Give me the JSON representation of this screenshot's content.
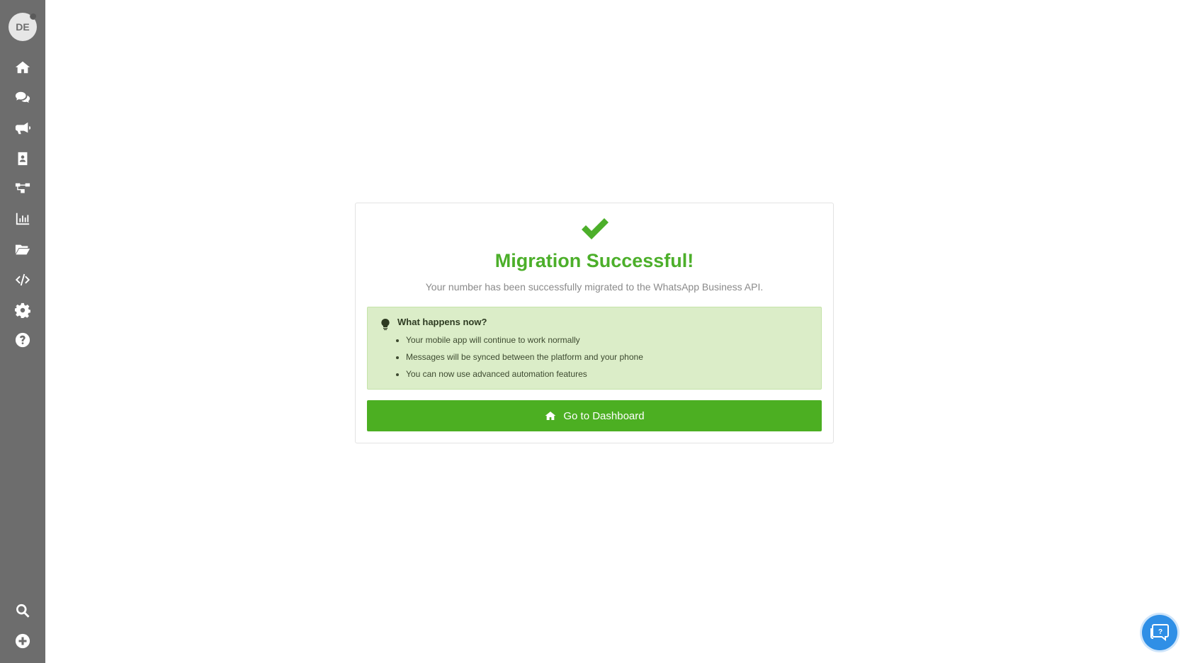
{
  "sidebar": {
    "avatar_initials": "DE",
    "items": [
      {
        "name": "home-icon"
      },
      {
        "name": "chat-icon"
      },
      {
        "name": "megaphone-icon"
      },
      {
        "name": "contacts-icon"
      },
      {
        "name": "flow-icon"
      },
      {
        "name": "chart-icon"
      },
      {
        "name": "folder-icon"
      },
      {
        "name": "code-icon"
      },
      {
        "name": "gear-icon"
      },
      {
        "name": "question-icon"
      }
    ],
    "bottom_items": [
      {
        "name": "search-icon"
      },
      {
        "name": "plus-circle-icon"
      }
    ]
  },
  "card": {
    "title": "Migration Successful!",
    "subtitle": "Your number has been successfully migrated to the WhatsApp Business API.",
    "info": {
      "title": "What happens now?",
      "items": [
        "Your mobile app will continue to work normally",
        "Messages will be synced between the platform and your phone",
        "You can now use advanced automation features"
      ]
    },
    "button_label": "Go to Dashboard"
  },
  "colors": {
    "sidebar_bg": "#6d6d6d",
    "success_green": "#4caf2a",
    "info_bg": "#dbedc8",
    "help_blue": "#2f8fe6"
  }
}
